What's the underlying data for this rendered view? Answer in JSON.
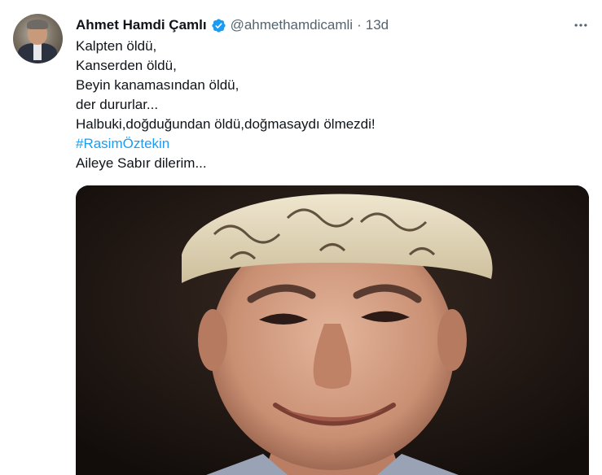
{
  "tweet": {
    "author_name": "Ahmet Hamdi Çamlı",
    "handle": "@ahmethamdicamli",
    "separator": "·",
    "time": "13d",
    "lines": [
      "Kalpten öldü,",
      "Kanserden öldü,",
      "Beyin kanamasından öldü,",
      "der dururlar...",
      "Halbuki,doğduğundan öldü,doğmasaydı ölmezdi!"
    ],
    "hashtag": "#RasimÖztekin",
    "closing_line": "Aileye Sabır dilerim..."
  },
  "icons": {
    "verified": "verified-badge-icon",
    "more": "more-options-icon"
  },
  "colors": {
    "accent": "#1d9bf0",
    "secondary_text": "#536471",
    "primary_text": "#0f1419"
  }
}
